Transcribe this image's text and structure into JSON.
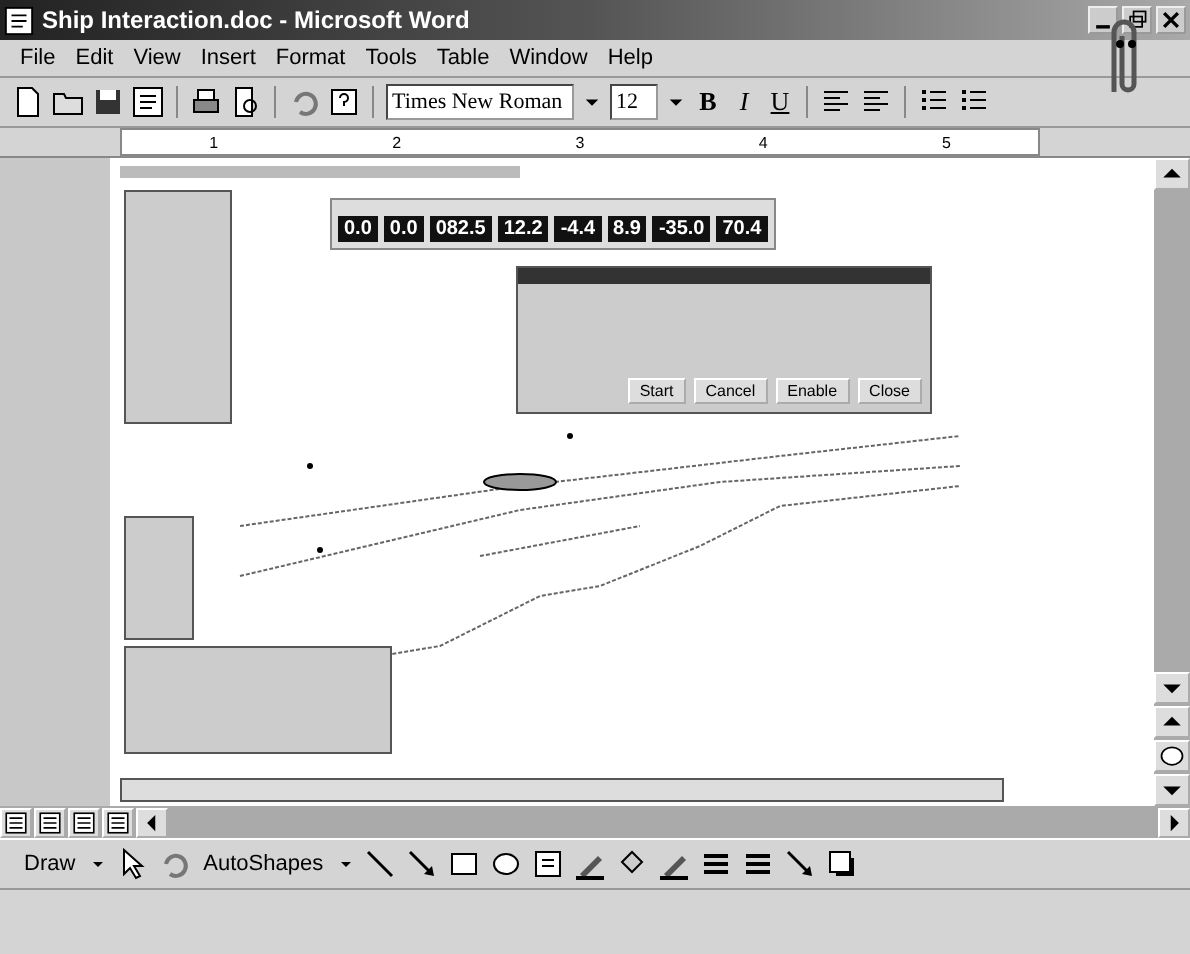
{
  "window": {
    "title": "Ship Interaction.doc - Microsoft Word"
  },
  "menu": [
    "File",
    "Edit",
    "View",
    "Insert",
    "Format",
    "Tools",
    "Table",
    "Window",
    "Help"
  ],
  "formatting": {
    "font": "Times New Roman",
    "size": "12",
    "styles": [
      "B",
      "I",
      "U"
    ]
  },
  "ruler": {
    "marks": [
      "1",
      "2",
      "3",
      "4",
      "5"
    ]
  },
  "embedded": {
    "readouts": [
      {
        "value": "0.0"
      },
      {
        "value": "0.0"
      },
      {
        "value": "082.5"
      },
      {
        "value": "12.2"
      },
      {
        "value": "-4.4"
      },
      {
        "value": "8.9"
      },
      {
        "value": "-35.0"
      },
      {
        "value": "70.4"
      }
    ],
    "dialog_buttons": [
      "Start",
      "Cancel",
      "Enable",
      "Close"
    ]
  },
  "draw_toolbar": {
    "draw": "Draw",
    "autoshapes": "AutoShapes"
  }
}
